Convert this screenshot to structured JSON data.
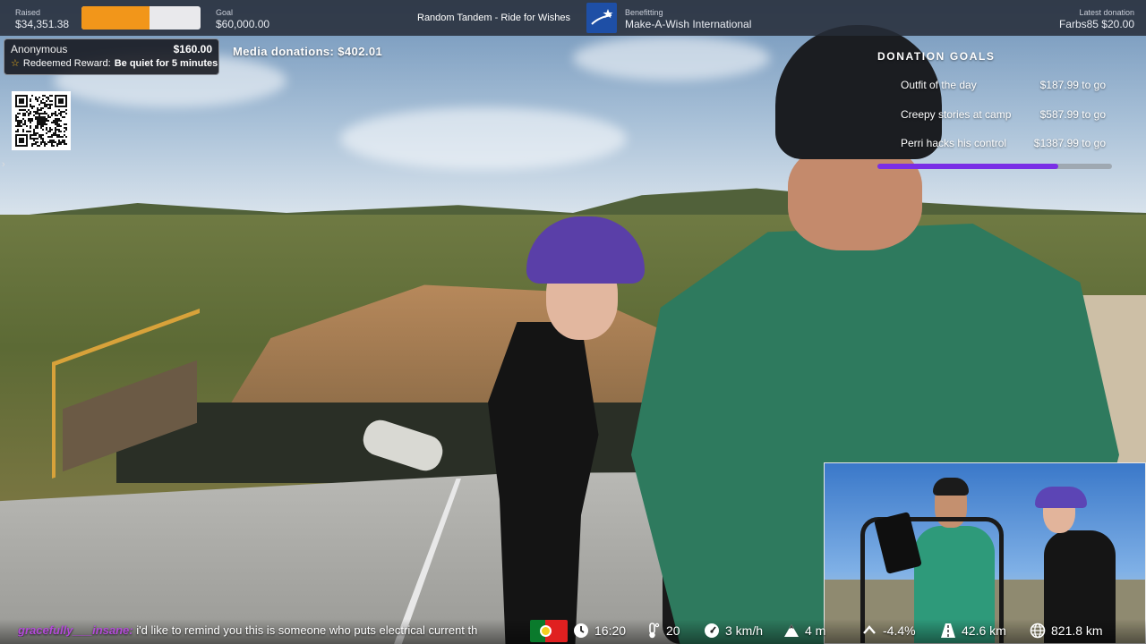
{
  "topbar": {
    "raised_label": "Raised",
    "raised_value": "$34,351.38",
    "raised_fraction": 0.573,
    "goal_label": "Goal",
    "goal_value": "$60,000.00",
    "title": "Random Tandem - Ride for Wishes",
    "beneficiary_label": "Benefitting",
    "beneficiary_name": "Make-A-Wish International",
    "latest_label": "Latest donation",
    "latest_value": "Farbs85 $20.00",
    "accent": "#f2961a"
  },
  "alert": {
    "donor": "Anonymous",
    "amount": "$160.00",
    "reward_prefix": "Redeemed Reward:",
    "reward": "Be quiet for 5 minutes"
  },
  "media_donations": "Media donations: $402.01",
  "donation_goals": {
    "title": "DONATION GOALS",
    "items": [
      {
        "name": "Outfit of the day",
        "amount": "$187.99 to go"
      },
      {
        "name": "Creepy stories at camp",
        "amount": "$587.99 to go"
      },
      {
        "name": "Perri hacks his control",
        "amount": "$1387.99 to go"
      }
    ],
    "progress_fraction": 0.77,
    "bar_color": "#7a2fe6"
  },
  "chat": {
    "username": "gracefully___insane",
    "separator": ":",
    "message": "i'd like to remind you this is someone who puts electrical current th"
  },
  "stats": {
    "time": "16:20",
    "temperature": "20",
    "speed": "3 km/h",
    "elevation": "4 m",
    "grade": "-4.4%",
    "distance": "42.6 km",
    "total_distance": "821.8 km"
  },
  "icons": {
    "flag": "portugal-flag-icon",
    "time": "clock-icon",
    "temperature": "thermometer-icon",
    "speed": "speedometer-icon",
    "elevation": "mountain-icon",
    "grade": "chevron-up-icon",
    "distance": "road-icon",
    "total_distance": "globe-icon"
  }
}
